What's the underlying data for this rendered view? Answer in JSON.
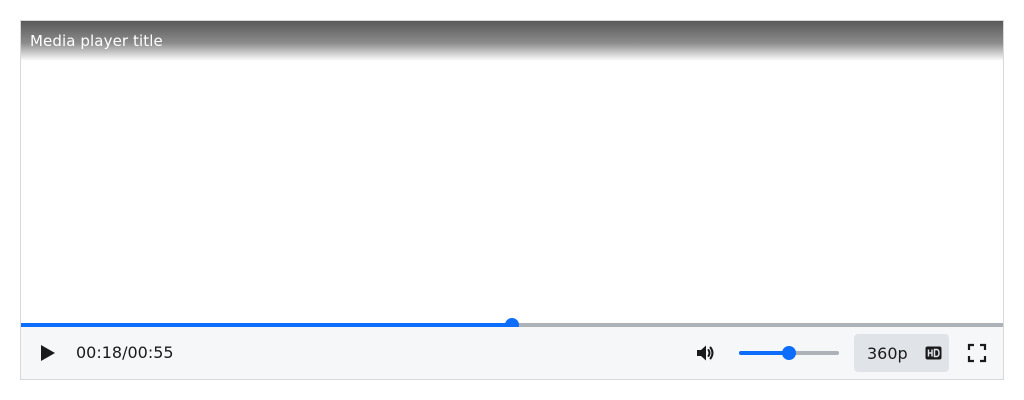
{
  "player": {
    "title": "Media player title",
    "current_time": "00:18",
    "duration": "00:55",
    "progress_fraction": 0.5,
    "volume_fraction": 0.5,
    "quality": "360p",
    "icons": {
      "play": "play-icon",
      "volume": "volume-icon",
      "hd": "hd-icon",
      "fullscreen": "fullscreen-icon"
    },
    "colors": {
      "accent": "#0d6efd",
      "track": "#adb2b8",
      "control_bar": "#f6f7f9",
      "quality_button": "#e0e3e7"
    }
  }
}
